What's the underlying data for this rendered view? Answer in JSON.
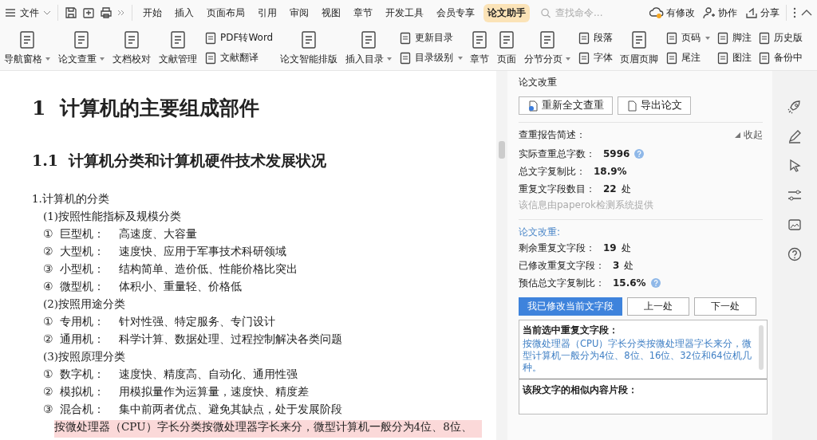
{
  "menu": {
    "file": "文件"
  },
  "tabs": [
    {
      "label": "开始",
      "selected": false
    },
    {
      "label": "插入",
      "selected": false
    },
    {
      "label": "页面布局",
      "selected": false
    },
    {
      "label": "引用",
      "selected": false
    },
    {
      "label": "审阅",
      "selected": false
    },
    {
      "label": "视图",
      "selected": false
    },
    {
      "label": "章节",
      "selected": false
    },
    {
      "label": "开发工具",
      "selected": false
    },
    {
      "label": "会员专享",
      "selected": false
    },
    {
      "label": "论文助手",
      "selected": true
    }
  ],
  "search": {
    "placeholder": "查找命令..."
  },
  "top_actions": [
    "有修改",
    "协作",
    "分享"
  ],
  "ribbon": [
    {
      "kind": "large",
      "label": "导航窗格",
      "dropdown": true
    },
    {
      "kind": "large",
      "label": "论文查重",
      "dropdown": true
    },
    {
      "kind": "large",
      "label": "文档校对",
      "dropdown": false
    },
    {
      "kind": "large",
      "label": "文献管理",
      "dropdown": false
    },
    {
      "kind": "stack",
      "items": [
        {
          "label": "PDF转Word",
          "dropdown": false
        },
        {
          "label": "文献翻译",
          "dropdown": false
        }
      ]
    },
    {
      "kind": "large",
      "label": "论文智能排版",
      "dropdown": false
    },
    {
      "kind": "large",
      "label": "插入目录",
      "dropdown": true
    },
    {
      "kind": "stack",
      "items": [
        {
          "label": "更新目录",
          "dropdown": false
        },
        {
          "label": "目录级别",
          "dropdown": true
        }
      ]
    },
    {
      "kind": "large",
      "label": "章节",
      "dropdown": false
    },
    {
      "kind": "large",
      "label": "页面",
      "dropdown": false
    },
    {
      "kind": "large",
      "label": "分节分页",
      "dropdown": true
    },
    {
      "kind": "stack",
      "items": [
        {
          "label": "段落",
          "dropdown": false
        },
        {
          "label": "字体",
          "dropdown": false
        }
      ]
    },
    {
      "kind": "large",
      "label": "页眉页脚",
      "dropdown": false
    },
    {
      "kind": "stack",
      "items": [
        {
          "label": "页码",
          "dropdown": true
        },
        {
          "label": "尾注",
          "dropdown": false
        }
      ]
    },
    {
      "kind": "stack",
      "items": [
        {
          "label": "脚注",
          "dropdown": false
        },
        {
          "label": "图注",
          "dropdown": false
        }
      ]
    },
    {
      "kind": "stack",
      "items": [
        {
          "label": "历史版",
          "dropdown": false
        },
        {
          "label": "备份中",
          "dropdown": false
        }
      ]
    }
  ],
  "document": [
    {
      "kind": "heading1",
      "num": "1",
      "text": "计算机的主要组成部件"
    },
    {
      "kind": "heading2",
      "num": "1.1",
      "text": "计算机分类和计算机硬件技术发展状况"
    },
    {
      "kind": "para",
      "text": "1.计算机的分类"
    },
    {
      "kind": "sub",
      "text": "(1)按照性能指标及规模分类"
    },
    {
      "kind": "item",
      "mark": "①",
      "label": "巨型机：",
      "desc": "高速度、大容量"
    },
    {
      "kind": "item",
      "mark": "②",
      "label": "大型机：",
      "desc": "速度快、应用于军事技术科研领域"
    },
    {
      "kind": "item",
      "mark": "③",
      "label": "小型机：",
      "desc": "结构简单、造价低、性能价格比突出"
    },
    {
      "kind": "item",
      "mark": "④",
      "label": "微型机：",
      "desc": "体积小、重量轻、价格低"
    },
    {
      "kind": "sub",
      "text": "(2)按照用途分类"
    },
    {
      "kind": "item",
      "mark": "①",
      "label": "专用机：",
      "desc": "针对性强、特定服务、专门设计"
    },
    {
      "kind": "item",
      "mark": "②",
      "label": "通用机：",
      "desc": "科学计算、数据处理、过程控制解决各类问题"
    },
    {
      "kind": "sub",
      "text": "(3)按照原理分类"
    },
    {
      "kind": "item",
      "mark": "①",
      "label": "数字机：",
      "desc": "速度快、精度高、自动化、通用性强"
    },
    {
      "kind": "item",
      "mark": "②",
      "label": "模拟机：",
      "desc": "用模拟量作为运算量，速度快、精度差"
    },
    {
      "kind": "item",
      "mark": "③",
      "label": "混合机：",
      "desc": "集中前两者优点、避免其缺点，处于发展阶段"
    },
    {
      "kind": "highlight",
      "text": "按微处理器（CPU）字长分类按微处理器字长来分，微型计算机一般分为4位、8位、"
    }
  ],
  "panel": {
    "title": "论文改重",
    "buttons": [
      "重新全文查重",
      "导出论文"
    ],
    "report_title": "查重报告简述：",
    "collapse": "收起",
    "report": [
      {
        "label": "实际查重总字数：",
        "value": "5996",
        "help": true
      },
      {
        "label": "总文字复制比：",
        "value": "18.9%",
        "help": false
      },
      {
        "label": "重复文字段数目：",
        "value": "22",
        "unit": "处",
        "help": false
      }
    ],
    "source": "该信息由paperok检测系统提供",
    "section_title": "论文改重:",
    "stats": [
      {
        "label": "剩余重复文字段：",
        "value": "19",
        "unit": "处",
        "help": false
      },
      {
        "label": "已修改重复文字段：",
        "value": "3",
        "unit": "处",
        "help": false
      },
      {
        "label": "预估总文字复制比：",
        "value": "15.6%",
        "help": true
      }
    ],
    "actions": [
      {
        "label": "我已修改当前文字段",
        "primary": true
      },
      {
        "label": "上一处",
        "primary": false
      },
      {
        "label": "下一处",
        "primary": false
      }
    ],
    "current_title": "当前选中重复文字段：",
    "current_text": "按微处理器（CPU）字长分类按微处理器字长来分，微型计算机一般分为4位、8位、16位、32位和64位机几种。",
    "similar_title": "该段文字的相似内容片段："
  }
}
